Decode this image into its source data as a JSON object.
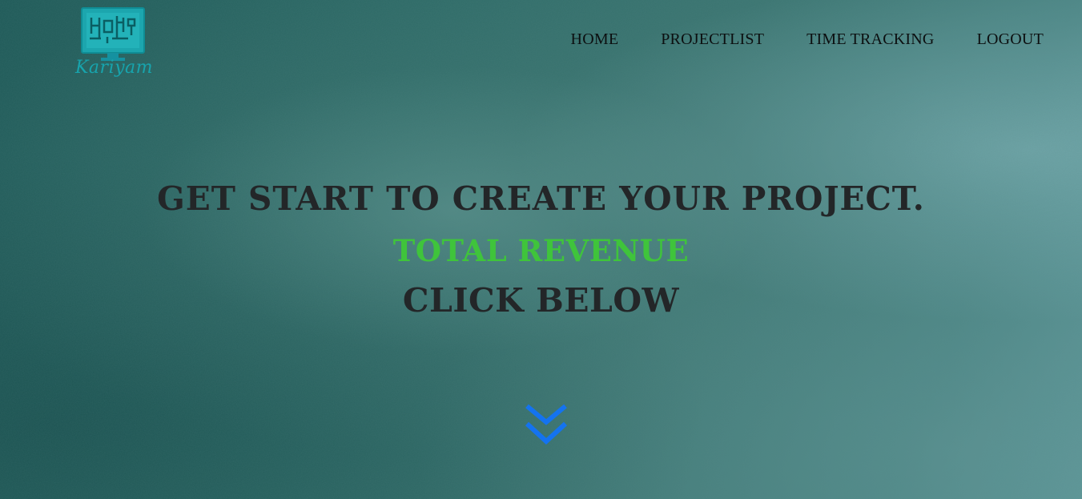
{
  "brand": {
    "logo_text": "Kariyam"
  },
  "nav": {
    "items": [
      {
        "label": "HOME"
      },
      {
        "label": "PROJECTLIST"
      },
      {
        "label": "TIME TRACKING"
      },
      {
        "label": "LOGOUT"
      }
    ]
  },
  "hero": {
    "headline": "GET START TO CREATE YOUR PROJECT.",
    "revenue_label": "TOTAL REVENUE",
    "cta_text": "CLICK BELOW",
    "scroll_icon": "double-chevron-down-icon"
  },
  "colors": {
    "accent_green": "#3fc43b",
    "chevron_blue": "#1473f0",
    "logo_teal": "#17a4ad",
    "text_dark": "#232628"
  }
}
